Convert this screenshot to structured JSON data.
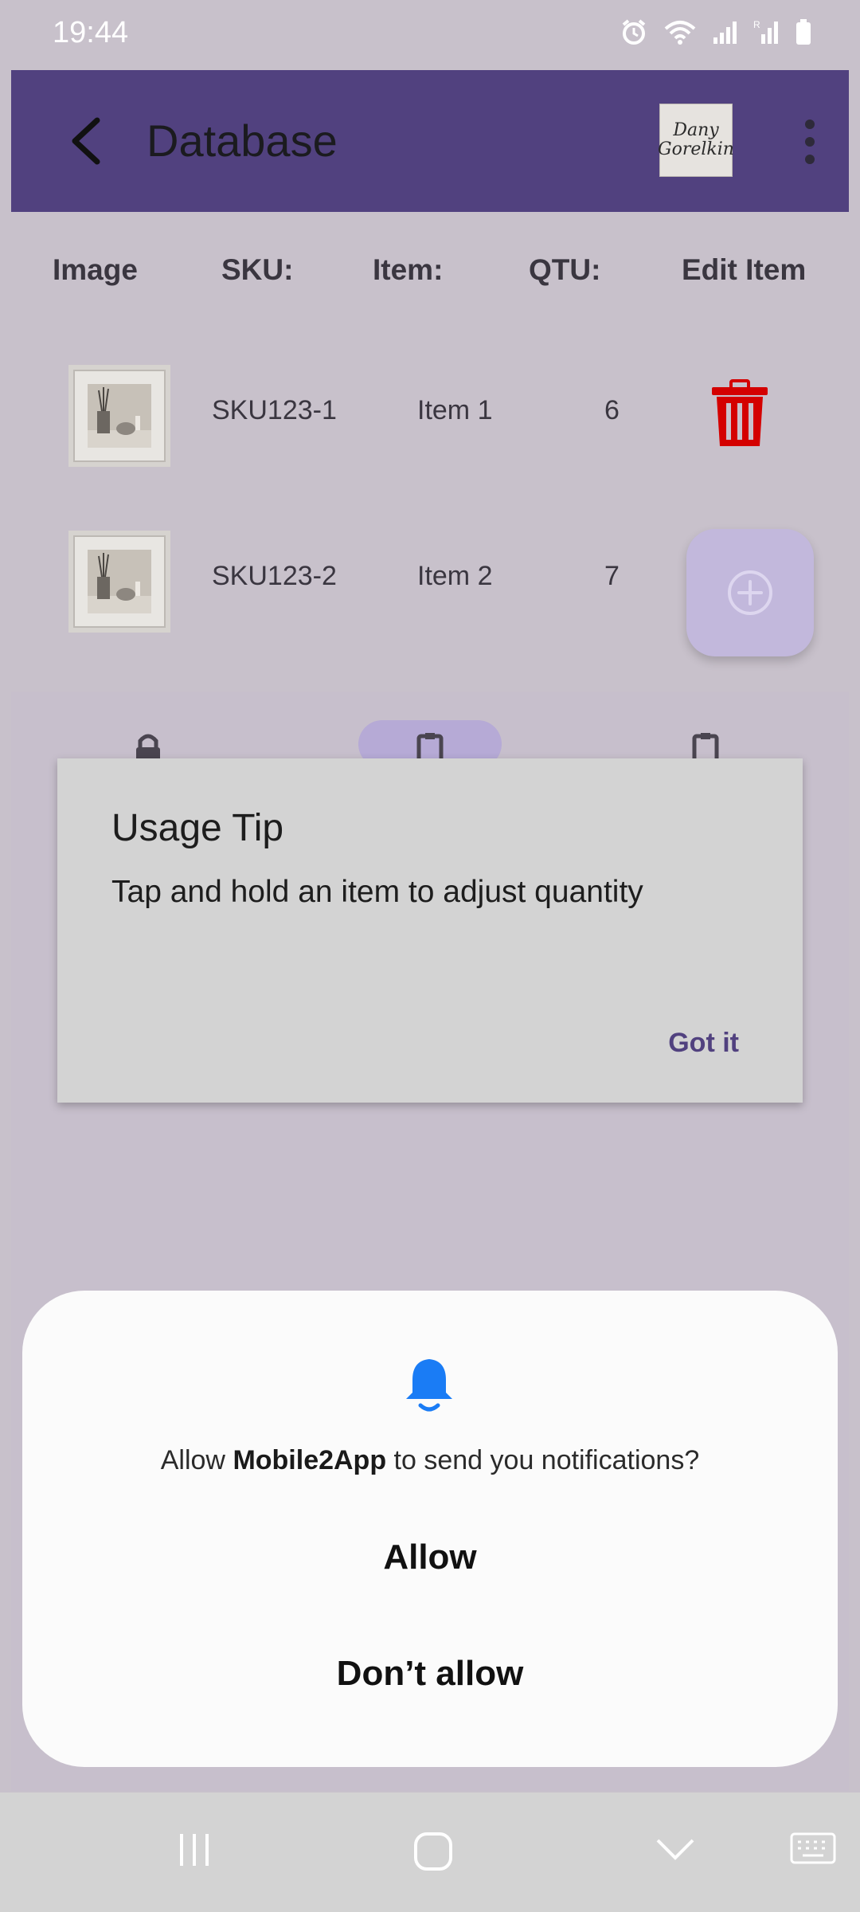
{
  "status_bar": {
    "time": "19:44",
    "icons": [
      "alarm-icon",
      "wifi-icon",
      "signal-icon",
      "roaming-signal-icon",
      "battery-icon"
    ]
  },
  "app_bar": {
    "title": "Database",
    "logo_text": [
      "Dany",
      "Gorelkin"
    ],
    "background": "#51417f"
  },
  "table": {
    "headers": [
      "Image",
      "SKU:",
      "Item:",
      "QTU:",
      "Edit Item"
    ],
    "rows": [
      {
        "sku": "SKU123-1",
        "item": "Item 1",
        "qty": "6"
      },
      {
        "sku": "SKU123-2",
        "item": "Item 2",
        "qty": "7"
      }
    ]
  },
  "tip_dialog": {
    "title": "Usage Tip",
    "body": "Tap and hold an item to adjust quantity",
    "button": "Got it"
  },
  "permission": {
    "msg_prefix": "Allow ",
    "app_name": "Mobile2App",
    "msg_suffix": " to send you notifications?",
    "allow": "Allow",
    "dont_allow": "Don’t allow",
    "accent": "#1a7cf5"
  },
  "colors": {
    "delete": "#d40000",
    "fab": "#c2b8dc"
  }
}
